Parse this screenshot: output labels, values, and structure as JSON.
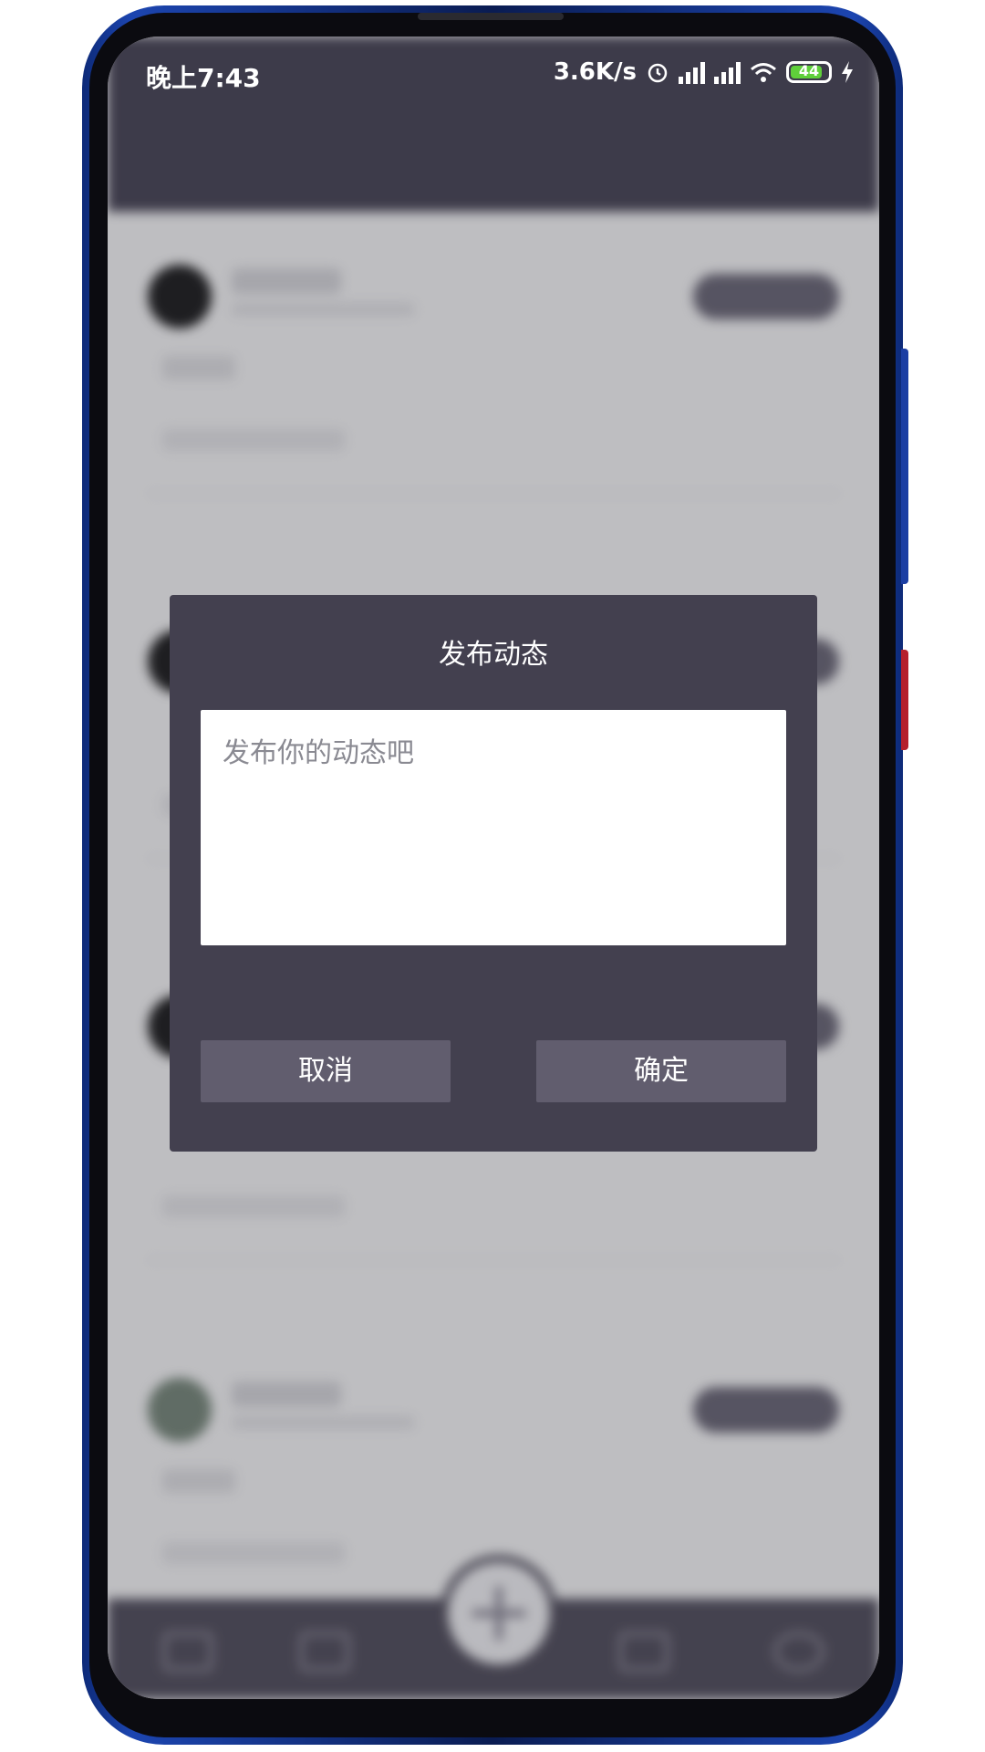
{
  "status_bar": {
    "time": "晚上7:43",
    "net_speed": "3.6K/s",
    "battery": "44",
    "icons": [
      "alarm-icon",
      "hd-signal-icon",
      "hd-signal-icon",
      "wifi-icon",
      "battery-icon",
      "charging-icon"
    ]
  },
  "dialog": {
    "title": "发布动态",
    "input_placeholder": "发布你的动态吧",
    "input_value": "",
    "cancel_label": "取消",
    "confirm_label": "确定"
  },
  "colors": {
    "dialog_bg": "#43404f",
    "button_bg": "#615d6e",
    "topbar_bg": "#4b4858",
    "battery_fill": "#5fcf3a"
  }
}
